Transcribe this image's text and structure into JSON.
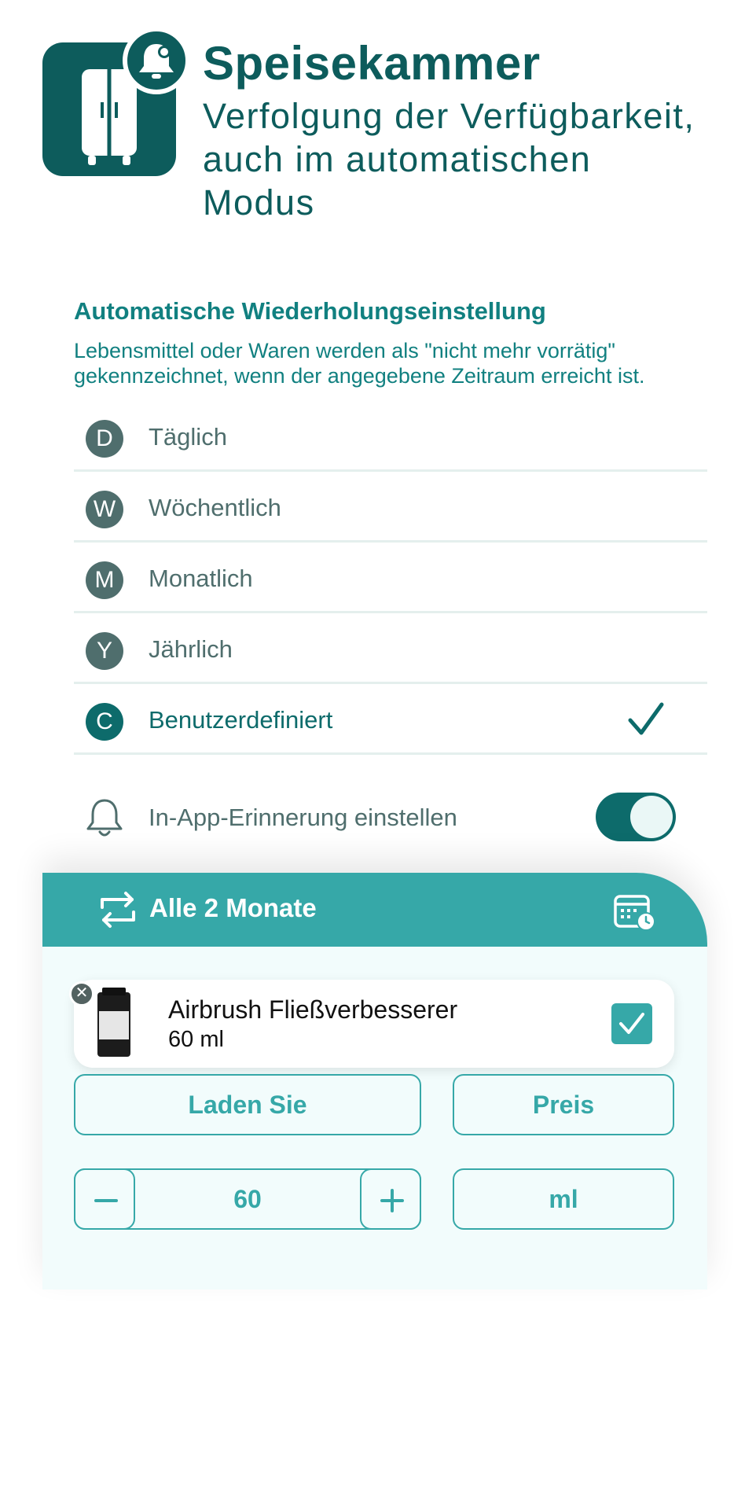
{
  "header": {
    "title": "Speisekammer",
    "subtitle": "Verfolgung der Verfügbarkeit, auch im automatischen Modus",
    "app_icon": "cabinet-icon",
    "badge_icon": "bell-icon"
  },
  "section": {
    "title": "Automatische Wiederholungseinstellung",
    "description": "Lebensmittel oder Waren werden als \"nicht mehr vorrätig\" gekennzeichnet, wenn der angegebene Zeitraum erreicht ist."
  },
  "options": [
    {
      "letter": "D",
      "label": "Täglich",
      "selected": false
    },
    {
      "letter": "W",
      "label": "Wöchentlich",
      "selected": false
    },
    {
      "letter": "M",
      "label": "Monatlich",
      "selected": false
    },
    {
      "letter": "Y",
      "label": "Jährlich",
      "selected": false
    },
    {
      "letter": "C",
      "label": "Benutzerdefiniert",
      "selected": true
    }
  ],
  "reminder": {
    "label": "In-App-Erinnerung einstellen",
    "enabled": true
  },
  "card": {
    "header_label": "Alle 2 Monate",
    "item": {
      "name": "Airbrush Fließverbesserer",
      "quantity": "60 ml",
      "checked": true
    },
    "store_label": "Laden Sie",
    "price_label": "Preis",
    "amount": "60",
    "unit": "ml"
  },
  "colors": {
    "primary": "#0d5c5c",
    "accent": "#36a8a8",
    "text_muted": "#4f6e6d"
  }
}
